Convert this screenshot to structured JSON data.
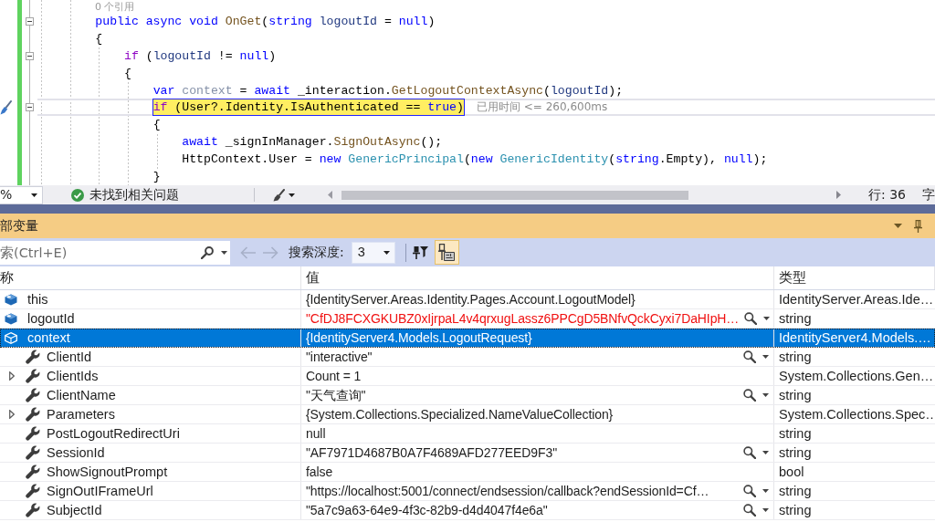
{
  "editor": {
    "codelens": "0 个引用",
    "lines": [
      {
        "collapsible": true,
        "current": false,
        "quick_action": false,
        "tokens": [
          {
            "text": "        public async void ",
            "kind": "keyword"
          },
          {
            "text": "OnGet",
            "kind": "method"
          },
          {
            "text": "(",
            "kind": "plain"
          },
          {
            "text": "string ",
            "kind": "keyword"
          },
          {
            "text": "logoutId",
            "kind": "param"
          },
          {
            "text": " = ",
            "kind": "plain"
          },
          {
            "text": "null",
            "kind": "keyword"
          },
          {
            "text": ")",
            "kind": "plain"
          }
        ]
      },
      {
        "collapsible": false,
        "current": false,
        "quick_action": false,
        "tokens": [
          {
            "text": "        {",
            "kind": "plain"
          }
        ]
      },
      {
        "collapsible": true,
        "current": false,
        "quick_action": false,
        "tokens": [
          {
            "text": "            if",
            "kind": "control"
          },
          {
            "text": " (",
            "kind": "plain"
          },
          {
            "text": "logoutId",
            "kind": "param"
          },
          {
            "text": " != ",
            "kind": "plain"
          },
          {
            "text": "null",
            "kind": "keyword"
          },
          {
            "text": ")",
            "kind": "plain"
          }
        ]
      },
      {
        "collapsible": false,
        "current": false,
        "quick_action": false,
        "tokens": [
          {
            "text": "            {",
            "kind": "plain"
          }
        ]
      },
      {
        "collapsible": false,
        "current": false,
        "quick_action": false,
        "tokens": [
          {
            "text": "                var ",
            "kind": "keyword"
          },
          {
            "text": "context",
            "kind": "unused"
          },
          {
            "text": " = ",
            "kind": "plain"
          },
          {
            "text": "await ",
            "kind": "keyword"
          },
          {
            "text": "_interaction.",
            "kind": "plain"
          },
          {
            "text": "GetLogoutContextAsync",
            "kind": "method"
          },
          {
            "text": "(",
            "kind": "plain"
          },
          {
            "text": "logoutId",
            "kind": "param"
          },
          {
            "text": ");",
            "kind": "plain"
          }
        ]
      },
      {
        "collapsible": true,
        "current": true,
        "quick_action": true,
        "perf_tip": "已用时间 <= 260,600ms",
        "tokens": [
          {
            "text": "                if",
            "kind": "control"
          },
          {
            "text": " (User?.Identity.IsAuthenticated == ",
            "kind": "plain"
          },
          {
            "text": "true",
            "kind": "keyword"
          },
          {
            "text": ")",
            "kind": "plain"
          }
        ]
      },
      {
        "collapsible": false,
        "current": false,
        "quick_action": false,
        "tokens": [
          {
            "text": "                {",
            "kind": "plain"
          }
        ]
      },
      {
        "collapsible": false,
        "current": false,
        "quick_action": false,
        "tokens": [
          {
            "text": "                    await ",
            "kind": "keyword"
          },
          {
            "text": "_signInManager.",
            "kind": "plain"
          },
          {
            "text": "SignOutAsync",
            "kind": "method"
          },
          {
            "text": "();",
            "kind": "plain"
          }
        ]
      },
      {
        "collapsible": false,
        "current": false,
        "quick_action": false,
        "tokens": [
          {
            "text": "                    HttpContext.User = ",
            "kind": "plain"
          },
          {
            "text": "new ",
            "kind": "keyword"
          },
          {
            "text": "GenericPrincipal",
            "kind": "type"
          },
          {
            "text": "(",
            "kind": "plain"
          },
          {
            "text": "new ",
            "kind": "keyword"
          },
          {
            "text": "GenericIdentity",
            "kind": "type"
          },
          {
            "text": "(",
            "kind": "plain"
          },
          {
            "text": "string",
            "kind": "keyword"
          },
          {
            "text": ".Empty), ",
            "kind": "plain"
          },
          {
            "text": "null",
            "kind": "keyword"
          },
          {
            "text": ");",
            "kind": "plain"
          }
        ]
      },
      {
        "collapsible": false,
        "current": false,
        "quick_action": false,
        "tokens": [
          {
            "text": "                }",
            "kind": "plain"
          }
        ]
      }
    ]
  },
  "status_bar": {
    "zoom": "%",
    "issues": "未找到相关问题",
    "line": "行: 36",
    "column": "字"
  },
  "locals": {
    "title": "部变量",
    "toolbar": {
      "search": {
        "placeholder": "索(Ctrl+E)"
      },
      "navigation": [
        {
          "disabled": true
        },
        {
          "disabled": true
        }
      ],
      "depth_label": "搜索深度:",
      "depth": "3",
      "toggles": [
        {
          "checked": false
        },
        {
          "checked": true
        }
      ]
    },
    "columns": [
      "称",
      "值",
      "类型"
    ],
    "rows": [
      {
        "name": "this",
        "kind": "variable",
        "value": "{IdentityServer.Areas.Identity.Pages.Account.LogoutModel}",
        "type": "IdentityServer.Areas.Ide…",
        "changed": false,
        "visualizer": false,
        "selected": false
      },
      {
        "name": "logoutId",
        "kind": "variable",
        "value": "\"CfDJ8FCXGKUBZ0xIjrpaL4v4qrxugLassz6PPCgD5BNfvQckCyxi7DaHIpH…",
        "type": "string",
        "changed": true,
        "visualizer": true,
        "selected": false
      },
      {
        "name": "context",
        "kind": "variable",
        "value": "{IdentityServer4.Models.LogoutRequest}",
        "type": "IdentityServer4.Models.…",
        "changed": false,
        "visualizer": false,
        "selected": true,
        "children": [
          {
            "name": "ClientId",
            "kind": "property",
            "expandable": false,
            "value": "\"interactive\"",
            "type": "string",
            "changed": false,
            "visualizer": true,
            "selected": false
          },
          {
            "name": "ClientIds",
            "kind": "property",
            "expandable": true,
            "value": "Count = 1",
            "type": "System.Collections.Gen…",
            "changed": false,
            "visualizer": false,
            "selected": false
          },
          {
            "name": "ClientName",
            "kind": "property",
            "expandable": false,
            "value": "\"天气查询\"",
            "type": "string",
            "changed": false,
            "visualizer": true,
            "selected": false
          },
          {
            "name": "Parameters",
            "kind": "property",
            "expandable": true,
            "value": "{System.Collections.Specialized.NameValueCollection}",
            "type": "System.Collections.Spec…",
            "changed": false,
            "visualizer": false,
            "selected": false
          },
          {
            "name": "PostLogoutRedirectUri",
            "kind": "property",
            "expandable": false,
            "value": "null",
            "type": "string",
            "changed": false,
            "visualizer": false,
            "selected": false
          },
          {
            "name": "SessionId",
            "kind": "property",
            "expandable": false,
            "value": "\"AF7971D4687B0A7F4689AFD277EED9F3\"",
            "type": "string",
            "changed": false,
            "visualizer": true,
            "selected": false
          },
          {
            "name": "ShowSignoutPrompt",
            "kind": "property",
            "expandable": false,
            "value": "false",
            "type": "bool",
            "changed": false,
            "visualizer": false,
            "selected": false
          },
          {
            "name": "SignOutIFrameUrl",
            "kind": "property",
            "expandable": false,
            "value": "\"https://localhost:5001/connect/endsession/callback?endSessionId=Cf…",
            "type": "string",
            "changed": false,
            "visualizer": true,
            "selected": false
          },
          {
            "name": "SubjectId",
            "kind": "property",
            "expandable": false,
            "value": "\"5a7c9a63-64e9-4f3c-82b9-d4d4047f4e6a\"",
            "type": "string",
            "changed": false,
            "visualizer": true,
            "selected": false
          }
        ]
      }
    ]
  }
}
